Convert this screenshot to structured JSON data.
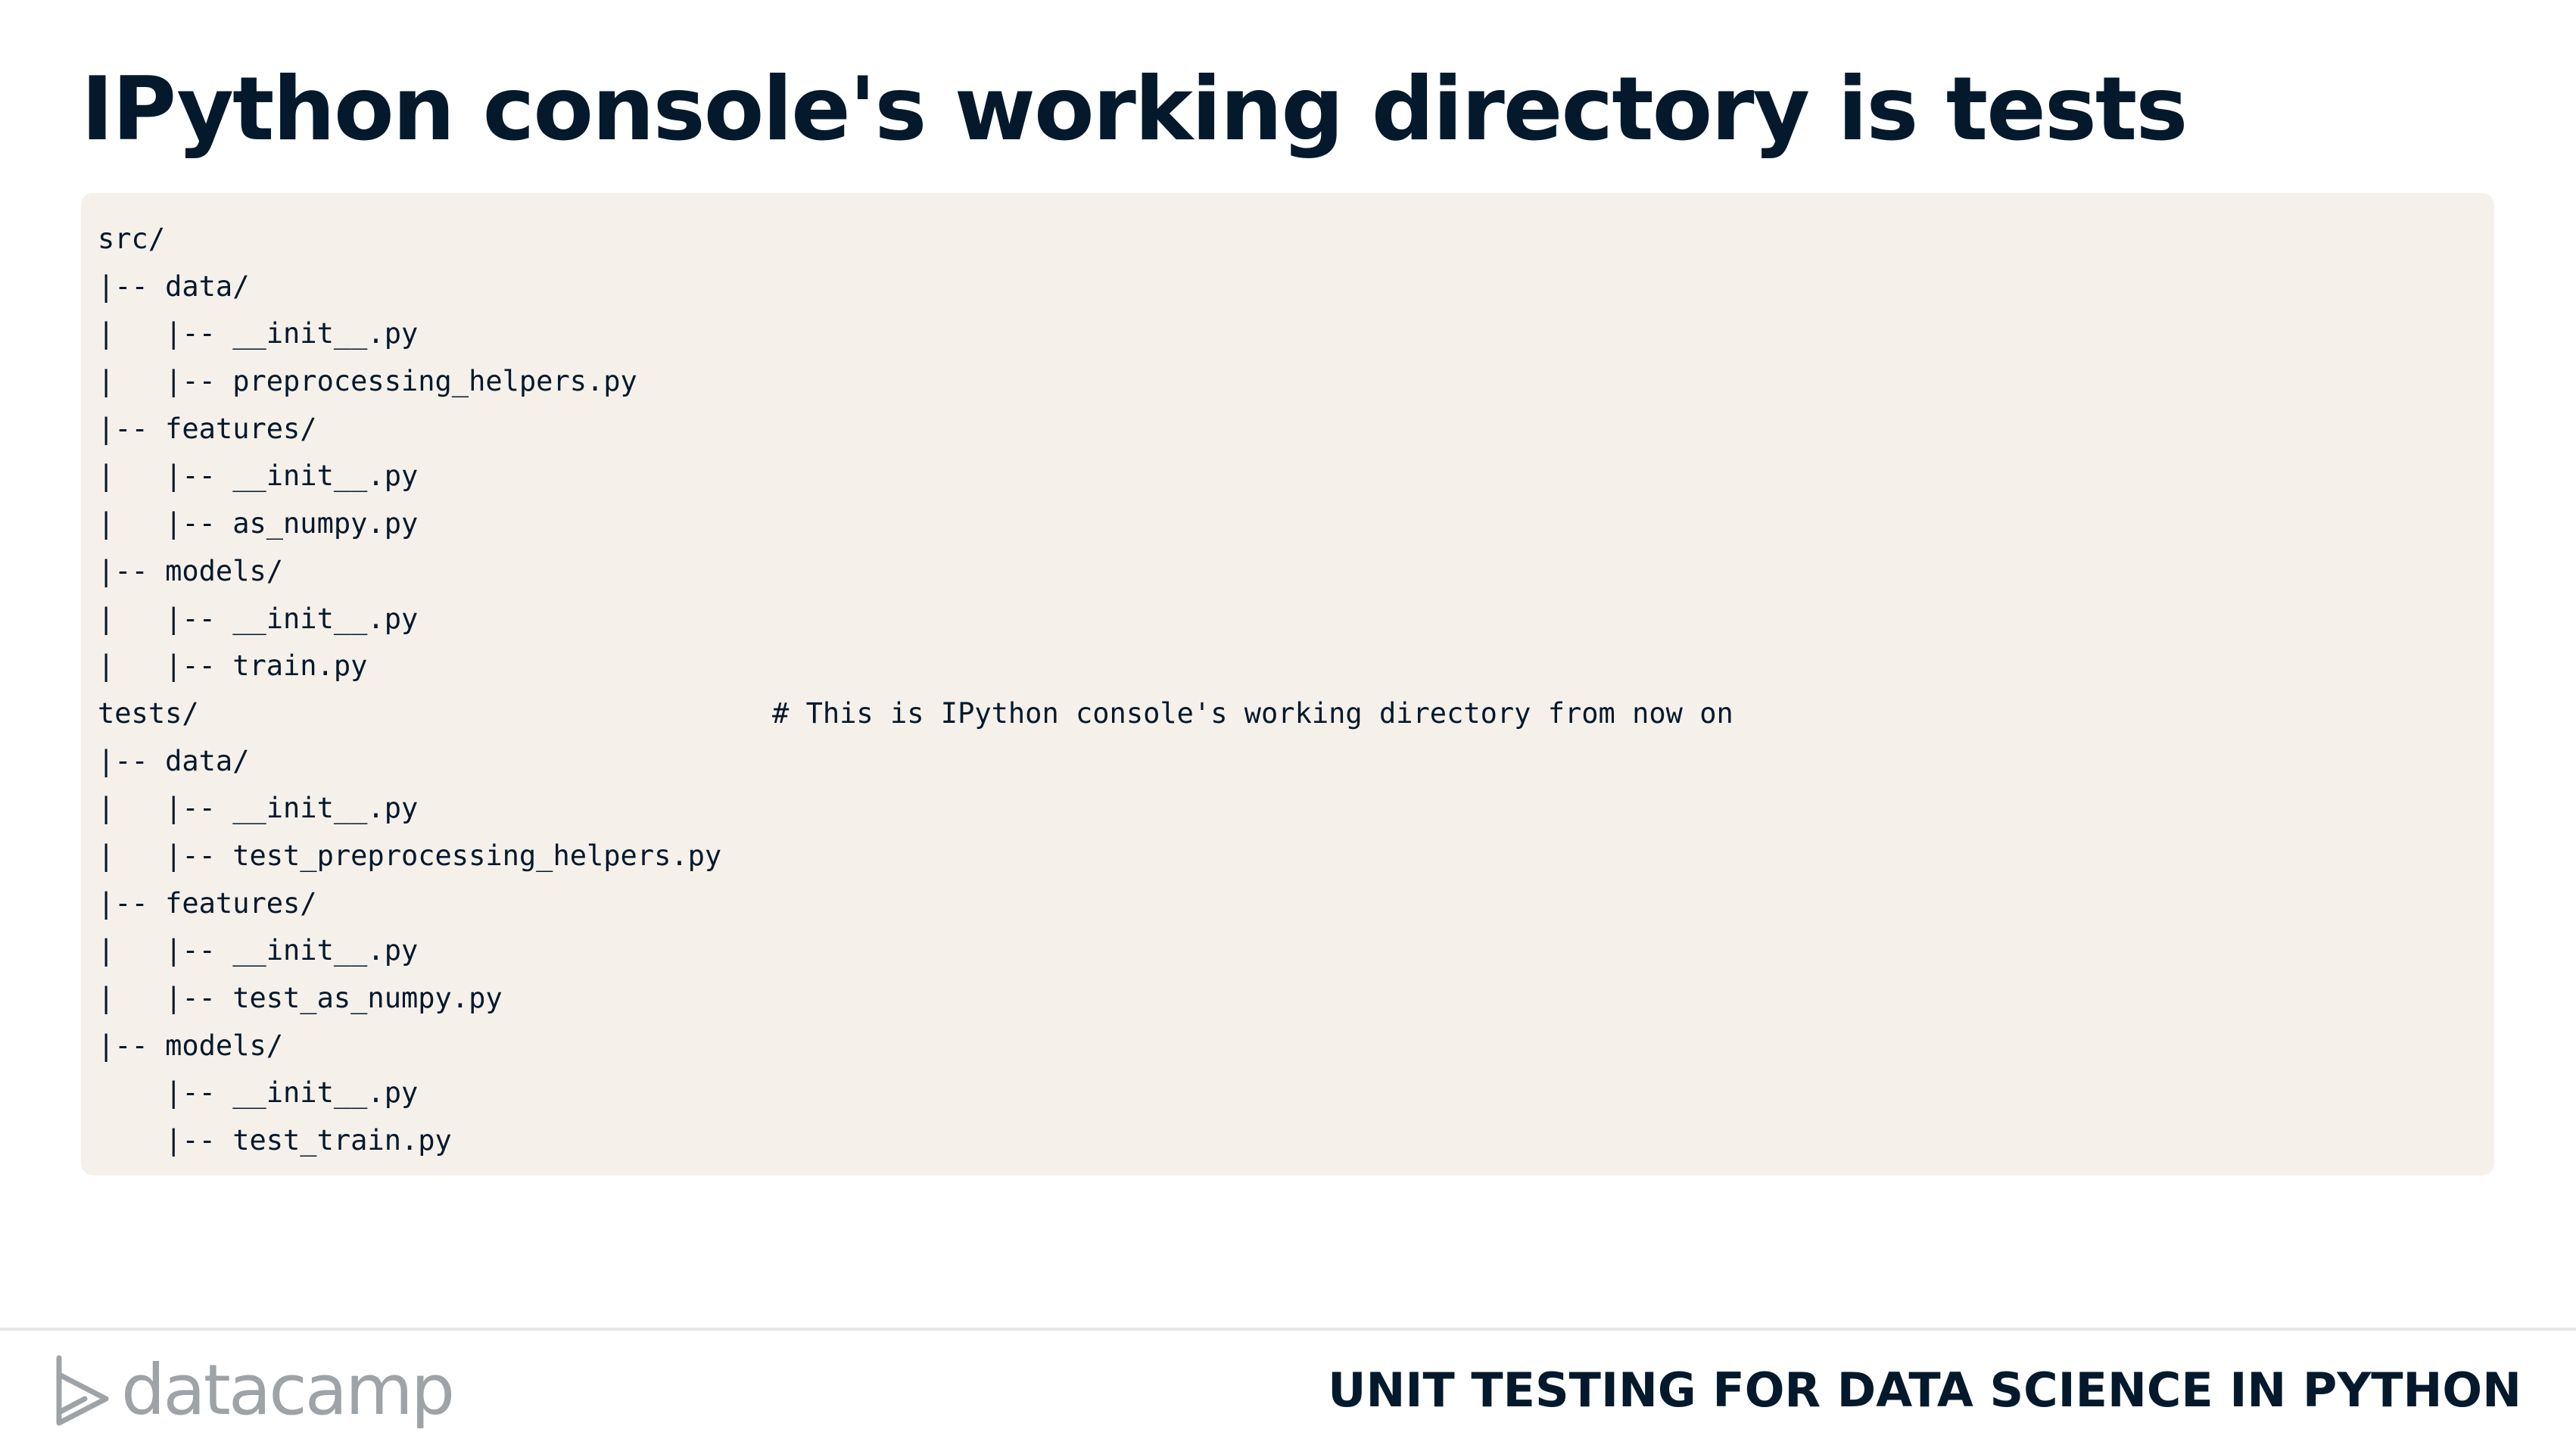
{
  "slide": {
    "title": "IPython console's working directory is tests"
  },
  "code": {
    "lines": [
      "src/",
      "|-- data/",
      "|   |-- __init__.py",
      "|   |-- preprocessing_helpers.py",
      "|-- features/",
      "|   |-- __init__.py",
      "|   |-- as_numpy.py",
      "|-- models/",
      "|   |-- __init__.py",
      "|   |-- train.py",
      "tests/                                  # This is IPython console's working directory from now on",
      "|-- data/",
      "|   |-- __init__.py",
      "|   |-- test_preprocessing_helpers.py",
      "|-- features/",
      "|   |-- __init__.py",
      "|   |-- test_as_numpy.py",
      "|-- models/",
      "    |-- __init__.py",
      "    |-- test_train.py"
    ]
  },
  "footer": {
    "logo_text": "datacamp",
    "logo_icon": "datacamp-logo-icon",
    "course_name": "UNIT TESTING FOR DATA SCIENCE IN PYTHON"
  },
  "colors": {
    "title": "#05192d",
    "code_background": "#f5f1ea",
    "logo": "#9ea3a8"
  }
}
